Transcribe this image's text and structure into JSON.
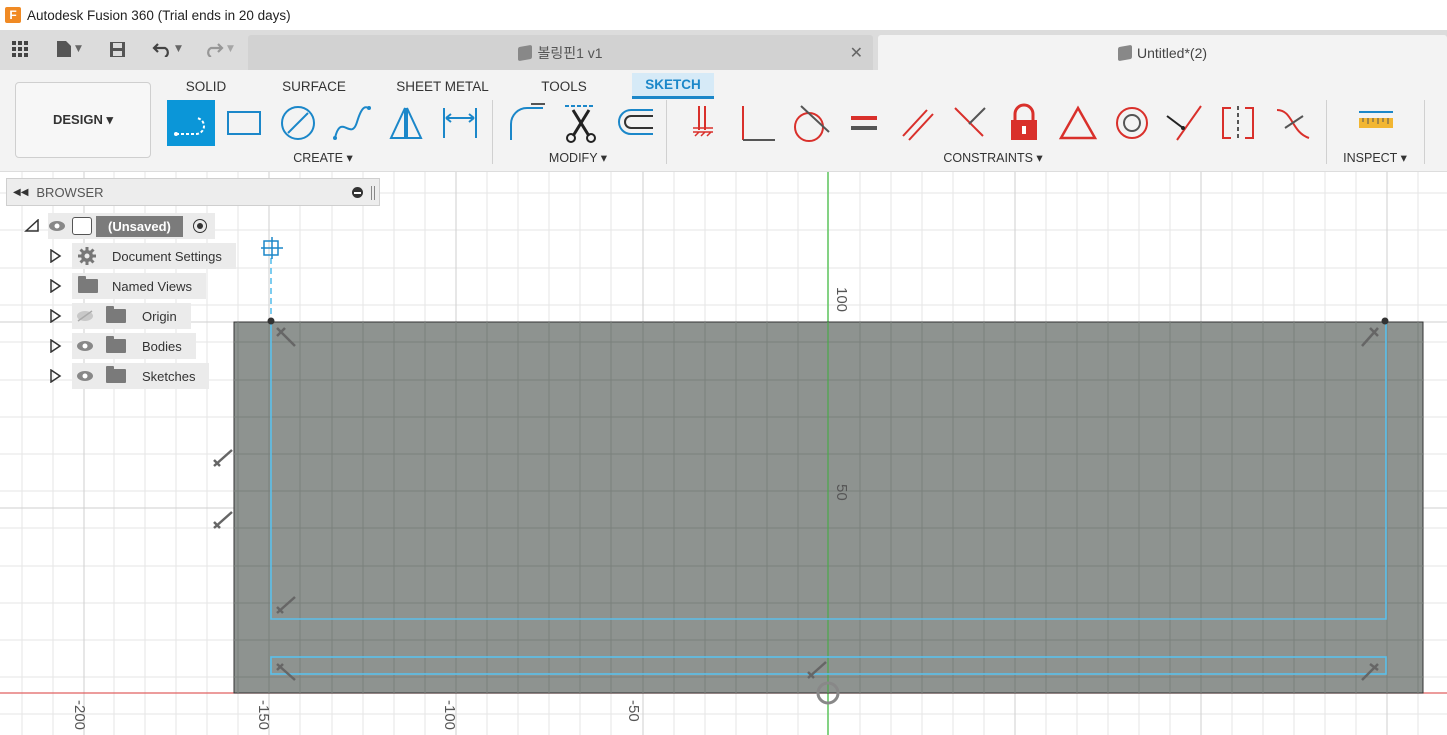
{
  "window": {
    "title": "Autodesk Fusion 360 (Trial ends in 20 days)",
    "logo_letter": "F"
  },
  "tabs": [
    {
      "label": "볼링핀1 v1",
      "active": false,
      "close": "✕"
    },
    {
      "label": "Untitled*(2)",
      "active": true
    }
  ],
  "workspace": {
    "label": "DESIGN ▾"
  },
  "ribbon_tabs": [
    "SOLID",
    "SURFACE",
    "SHEET METAL",
    "TOOLS",
    "SKETCH"
  ],
  "groups": {
    "create": "CREATE ▾",
    "modify": "MODIFY ▾",
    "constraints": "CONSTRAINTS ▾",
    "inspect": "INSPECT ▾"
  },
  "browser": {
    "title": "BROWSER",
    "root": "(Unsaved)",
    "items": [
      "Document Settings",
      "Named Views",
      "Origin",
      "Bodies",
      "Sketches"
    ]
  },
  "axis": {
    "x_ticks": [
      "-200",
      "-150",
      "-100",
      "-50"
    ],
    "y_ticks": [
      "100",
      "50"
    ]
  },
  "colors": {
    "accent": "#0b96d8",
    "sketch_line": "#5bc0eb",
    "profile_fill": "#8e9390",
    "constraint_red": "#d9302b"
  }
}
